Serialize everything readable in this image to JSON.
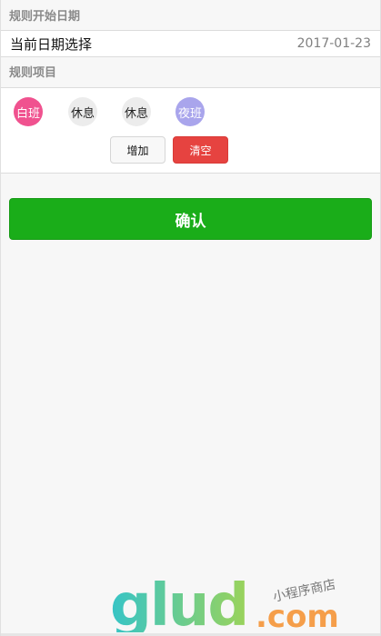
{
  "start_section": {
    "title": "规则开始日期"
  },
  "date_cell": {
    "label": "当前日期选择",
    "value": "2017-01-23"
  },
  "rule_section": {
    "title": "规则项目"
  },
  "rule_items": [
    {
      "label": "白班",
      "color": "#f0528f"
    },
    {
      "label": "休息",
      "color": "#ececec"
    },
    {
      "label": "休息",
      "color": "#ececec"
    },
    {
      "label": "夜班",
      "color": "#a9a5ec"
    }
  ],
  "buttons": {
    "add": "增加",
    "clear": "清空",
    "confirm": "确认"
  },
  "watermark": {
    "brand": "glud",
    "suffix": ".com",
    "tagline": "小程序商店"
  }
}
